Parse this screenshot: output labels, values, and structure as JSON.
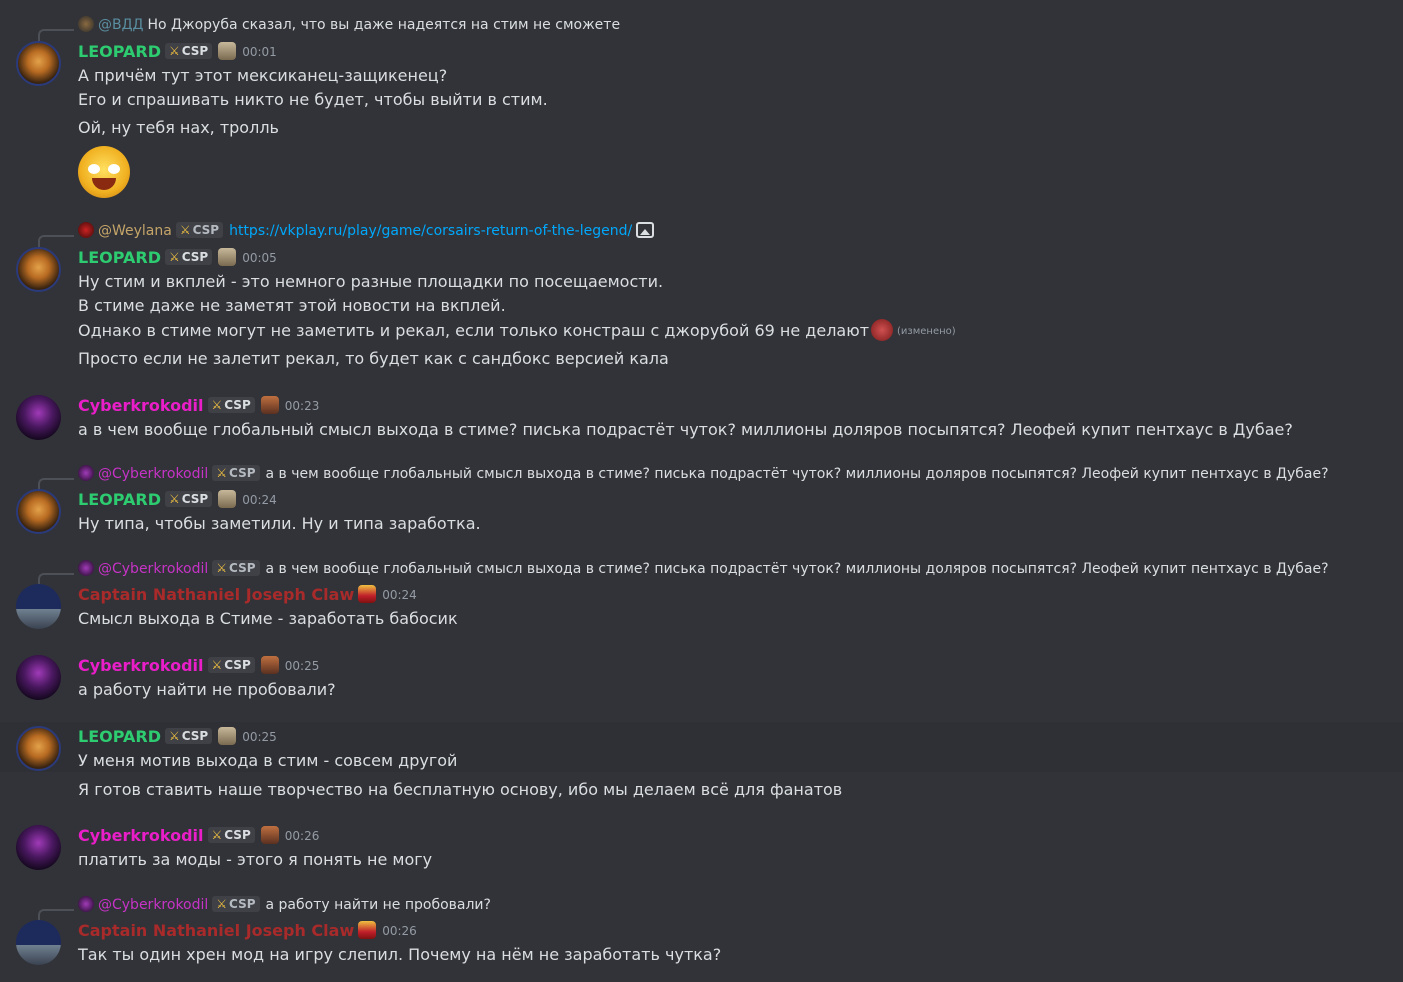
{
  "messages": [
    {
      "reply": {
        "name": "@ВДД",
        "text": "Но Джоруба сказал, что вы даже надеятся на стим не сможете"
      },
      "author": "LEOPARD",
      "tag": "CSP",
      "time": "00:01",
      "lines": [
        "А причём тут этот мексиканец-защикенец?",
        "Его и спрашивать никто не будет, чтобы выйти в стим.",
        "Ой, ну тебя нах, тролль"
      ],
      "emoji": "crying-laughing-emoji"
    },
    {
      "reply": {
        "name": "@Weylana",
        "tag": "CSP",
        "link": "https://vkplay.ru/play/game/corsairs-return-of-the-legend/"
      },
      "author": "LEOPARD",
      "tag": "CSP",
      "time": "00:05",
      "lines": [
        "Ну стим и вкплей - это немного разные площадки по посещаемости.",
        "В стиме даже не заметят этой новости на вкплей.",
        "Однако в стиме могут не заметить и рекал, если только констраш с джорубой 69 не делают",
        "Просто если не залетит рекал, то будет как с сандбокс версией кала"
      ],
      "edited": "(изменено)"
    },
    {
      "author": "Cyberkrokodil",
      "tag": "CSP",
      "time": "00:23",
      "lines": [
        "а в чем вообще глобальный смысл выхода в стиме? писька подрастёт чуток? миллионы доляров посыпятся? Леофей купит пентхаус в Дубае?"
      ]
    },
    {
      "reply": {
        "name": "@Cyberkrokodil",
        "tag": "CSP",
        "text": "а в чем вообще глобальный смысл выхода в стиме? писька подрастёт чуток? миллионы доляров посыпятся? Леофей купит пентхаус в Дубае?"
      },
      "author": "LEOPARD",
      "tag": "CSP",
      "time": "00:24",
      "lines": [
        "Ну типа, чтобы заметили. Ну и типа заработка."
      ]
    },
    {
      "reply": {
        "name": "@Cyberkrokodil",
        "tag": "CSP",
        "text": "а в чем вообще глобальный смысл выхода в стиме? писька подрастёт чуток? миллионы доляров посыпятся? Леофей купит пентхаус в Дубае?"
      },
      "author": "Captain Nathaniel Joseph Claw",
      "time": "00:24",
      "lines": [
        "Смысл выхода в Стиме - заработать бабосик"
      ]
    },
    {
      "author": "Cyberkrokodil",
      "tag": "CSP",
      "time": "00:25",
      "lines": [
        "а работу найти не пробовали?"
      ]
    },
    {
      "author": "LEOPARD",
      "tag": "CSP",
      "time": "00:25",
      "lines": [
        "У меня мотив выхода в стим - совсем другой",
        "Я готов ставить наше творчество на бесплатную основу, ибо мы делаем всё для фанатов"
      ]
    },
    {
      "author": "Cyberkrokodil",
      "tag": "CSP",
      "time": "00:26",
      "lines": [
        "платить за моды - этого я понять не могу"
      ]
    },
    {
      "reply": {
        "name": "@Cyberkrokodil",
        "tag": "CSP",
        "text": "а работу найти не пробовали?"
      },
      "author": "Captain Nathaniel Joseph Claw",
      "time": "00:26",
      "lines": [
        "Так ты один хрен мод на игру слепил. Почему на нём не заработать чутка?"
      ]
    }
  ]
}
